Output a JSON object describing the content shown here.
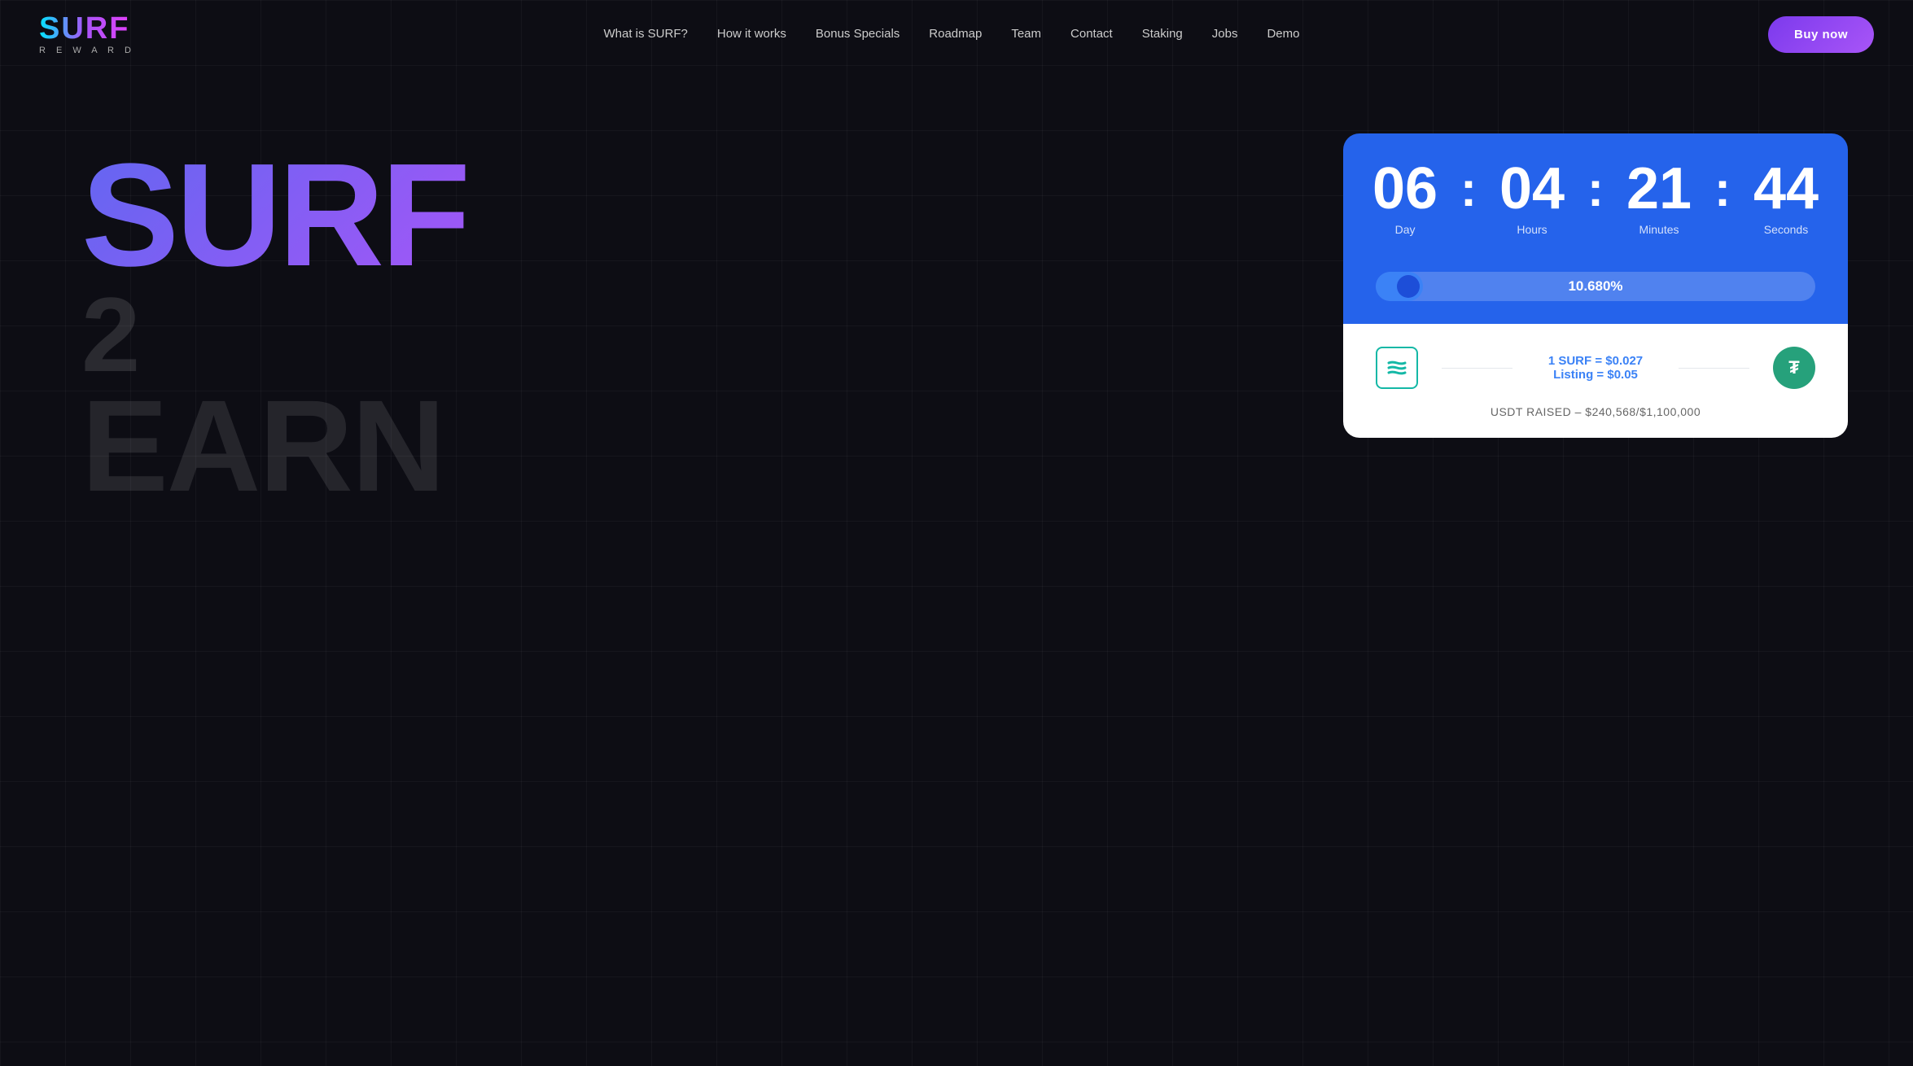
{
  "logo": {
    "surf": "SURF",
    "reward": "R E W A R D"
  },
  "nav": {
    "links": [
      {
        "id": "what-is-surf",
        "label": "What is SURF?"
      },
      {
        "id": "how-it-works",
        "label": "How it works"
      },
      {
        "id": "bonus-specials",
        "label": "Bonus Specials"
      },
      {
        "id": "roadmap",
        "label": "Roadmap"
      },
      {
        "id": "team",
        "label": "Team"
      },
      {
        "id": "contact",
        "label": "Contact"
      },
      {
        "id": "staking",
        "label": "Staking"
      },
      {
        "id": "jobs",
        "label": "Jobs"
      },
      {
        "id": "demo",
        "label": "Demo"
      }
    ],
    "buy_button": "Buy now"
  },
  "hero": {
    "title_surf": "SURF",
    "title_2": "2",
    "title_earn": "EARN"
  },
  "countdown": {
    "days": {
      "value": "06",
      "label": "Day"
    },
    "hours": {
      "value": "04",
      "label": "Hours"
    },
    "minutes": {
      "value": "21",
      "label": "Minutes"
    },
    "seconds": {
      "value": "44",
      "label": "Seconds"
    },
    "separators": [
      ":",
      ":",
      ":"
    ],
    "progress_percent": "10.680%",
    "price_line1": "1 SURF = $0.027",
    "price_line2": "Listing = $0.05",
    "usdt_raised": "USDT RAISED – $240,568/$1,100,000",
    "surf_icon_text": "S",
    "tether_icon_text": "₮"
  }
}
